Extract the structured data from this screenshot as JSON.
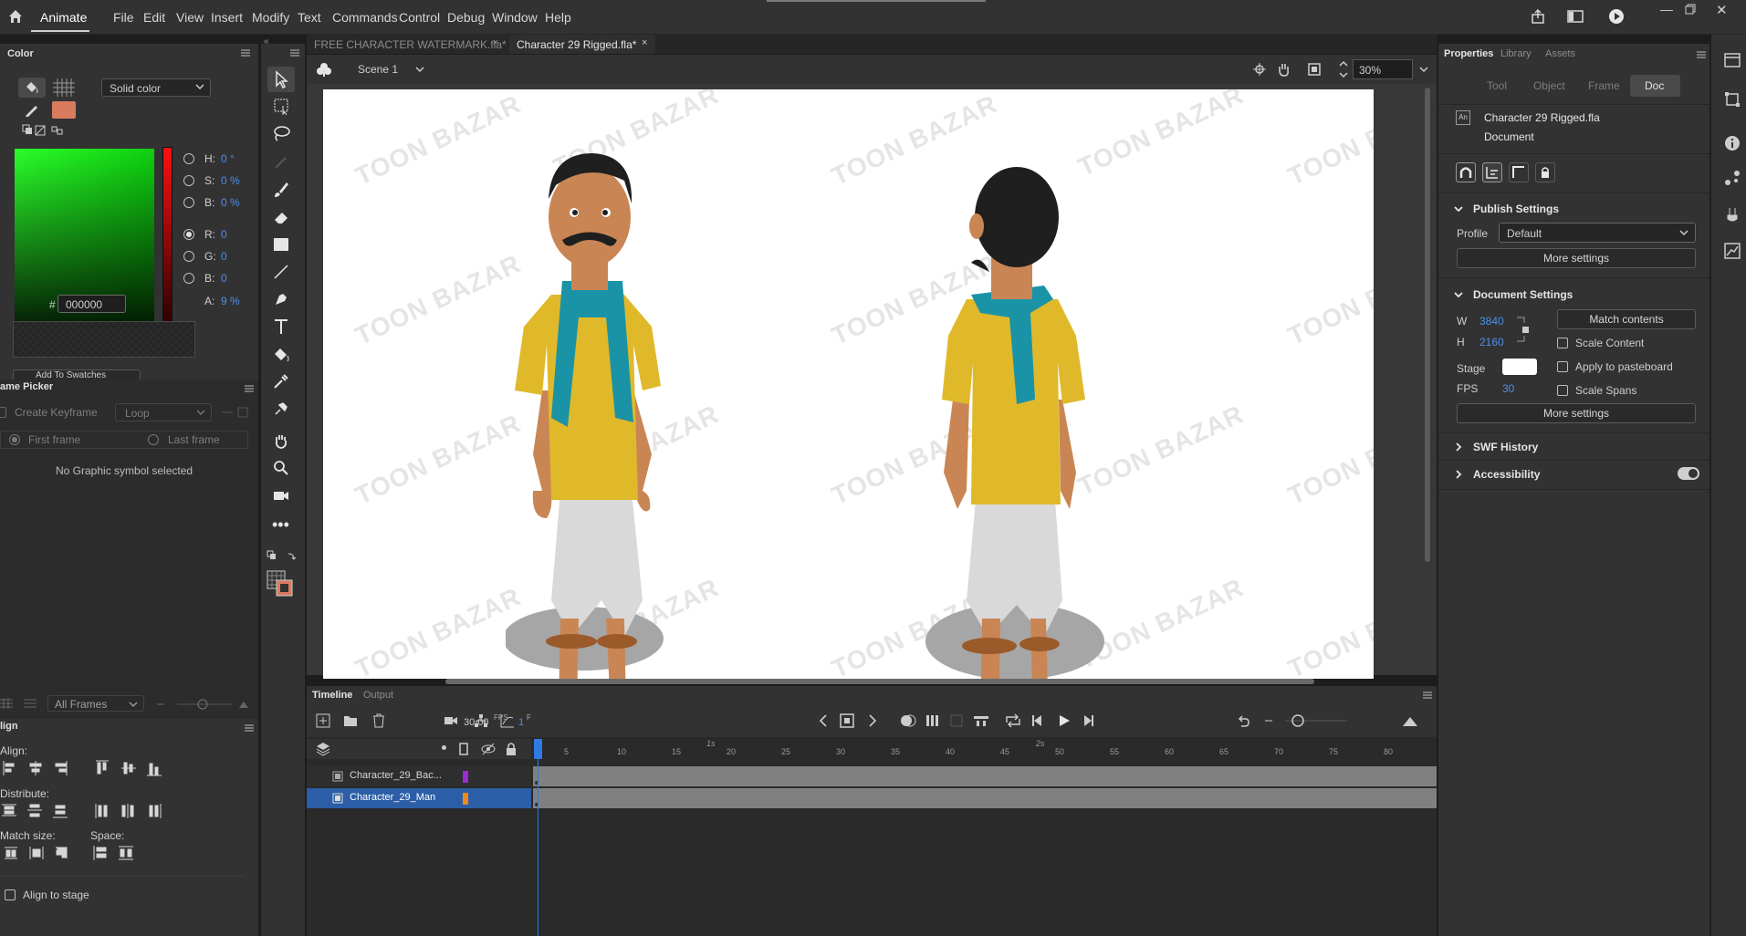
{
  "menu": {
    "app_name": "Animate",
    "items": [
      "File",
      "Edit",
      "View",
      "Insert",
      "Modify",
      "Text",
      "Commands",
      "Control",
      "Debug",
      "Window",
      "Help"
    ]
  },
  "doc_tabs": [
    {
      "label": "FREE CHARACTER WATERMARK.fla*",
      "active": false
    },
    {
      "label": "Character 29 Rigged.fla*",
      "active": true
    }
  ],
  "stage_toolbar": {
    "scene": "Scene 1",
    "zoom": "30%"
  },
  "color_panel": {
    "title": "Color",
    "fill_type": "Solid color",
    "h_label": "H:",
    "h_value": "0 °",
    "s_label": "S:",
    "s_value": "0 %",
    "b1_label": "B:",
    "b1_value": "0 %",
    "r_label": "R:",
    "r_value": "0",
    "g_label": "G:",
    "g_value": "0",
    "b2_label": "B:",
    "b2_value": "0",
    "a_label": "A:",
    "a_value": "9 %",
    "hex_label": "#",
    "hex_value": "000000",
    "fill_color": "#d97b5e",
    "add_swatch": "Add To Swatches"
  },
  "frame_picker": {
    "title": "ame Picker",
    "create_keyframe": "Create Keyframe",
    "loop": "Loop",
    "first_frame": "First frame",
    "last_frame": "Last frame",
    "empty": "No Graphic symbol selected",
    "all_frames": "All Frames"
  },
  "align_panel": {
    "title": "lign",
    "align": "Align:",
    "distribute": "Distribute:",
    "match_size": "Match size:",
    "space": "Space:",
    "align_to_stage": "Align to stage"
  },
  "properties": {
    "tabs": [
      "Properties",
      "Library",
      "Assets"
    ],
    "sub_tabs": [
      "Tool",
      "Object",
      "Frame",
      "Doc"
    ],
    "doc_name": "Character 29 Rigged.fla",
    "doc_type": "Document",
    "doc_icon": "An",
    "publish_settings": "Publish Settings",
    "profile_label": "Profile",
    "profile_value": "Default",
    "more_settings": "More settings",
    "document_settings": "Document Settings",
    "w_label": "W",
    "w_value": "3840",
    "h_label": "H",
    "h_value": "2160",
    "match_contents": "Match contents",
    "scale_content": "Scale Content",
    "apply_pasteboard": "Apply to pasteboard",
    "scale_spans": "Scale Spans",
    "stage_label": "Stage",
    "stage_color": "#ffffff",
    "fps_label": "FPS",
    "fps_value": "30",
    "swf_history": "SWF History",
    "accessibility": "Accessibility"
  },
  "stage": {
    "watermark": "TOON BAZAR"
  },
  "timeline": {
    "tabs": [
      "Timeline",
      "Output"
    ],
    "fps": "30.00",
    "fps_unit": "FPS",
    "frame": "1",
    "frame_unit": "F",
    "layers": [
      {
        "name": "Character_29_Bac...",
        "color": "#9b2bd1",
        "selected": false
      },
      {
        "name": "Character_29_Man",
        "color": "#f08a1c",
        "selected": true
      }
    ],
    "ruler_ticks": [
      "5",
      "10",
      "15",
      "20",
      "25",
      "30",
      "35",
      "40",
      "45",
      "50",
      "55",
      "60",
      "65",
      "70",
      "75",
      "80"
    ],
    "second_labels": [
      "1s",
      "2s"
    ]
  }
}
